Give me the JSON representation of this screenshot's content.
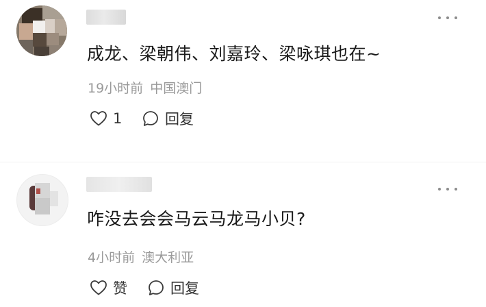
{
  "comments": [
    {
      "text": "成龙、梁朝伟、刘嘉玲、梁咏琪也在~",
      "time": "19小时前",
      "location": "中国澳门",
      "like_label": "1",
      "reply_label": "回复"
    },
    {
      "text": "咋没去会会马云马龙马小贝?",
      "time": "4小时前",
      "location": "澳大利亚",
      "like_label": "赞",
      "reply_label": "回复"
    }
  ],
  "colors": {
    "text": "#1a1a1a",
    "meta": "#9a9a9a",
    "action": "#333333",
    "icon": "#3a3a3a"
  },
  "icons": [
    "more-icon",
    "heart-icon",
    "comment-bubble-icon"
  ]
}
